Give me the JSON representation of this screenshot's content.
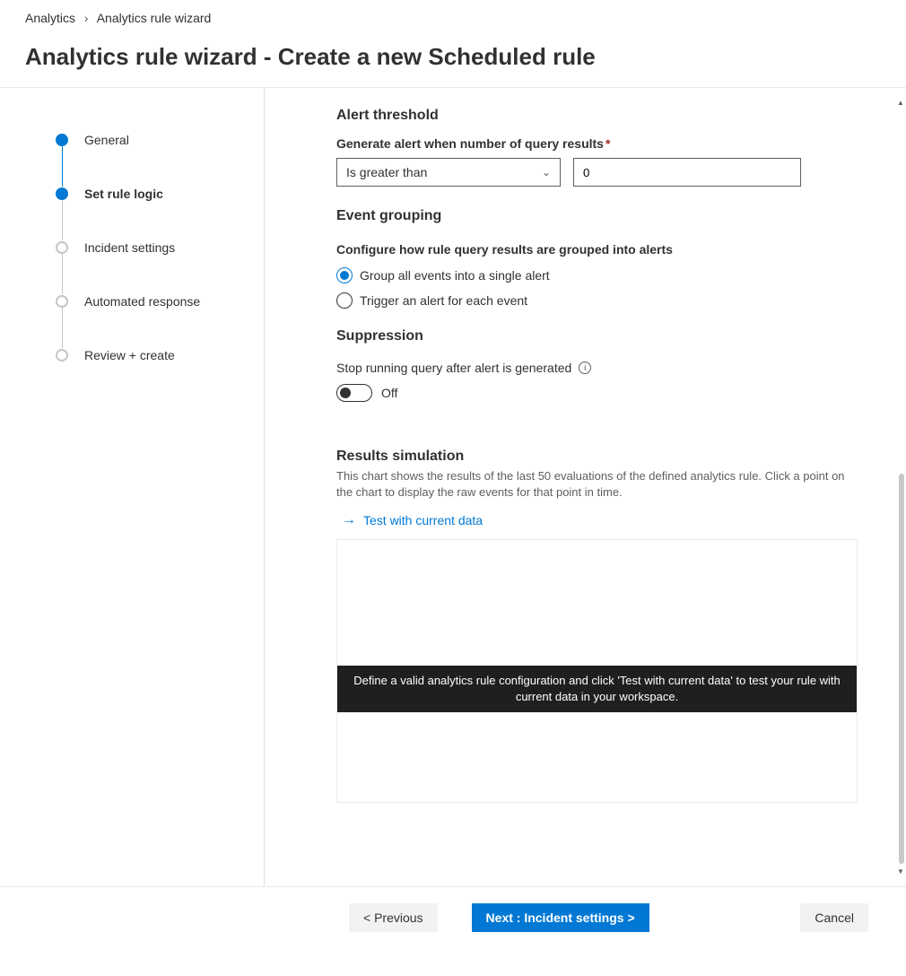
{
  "breadcrumb": {
    "root": "Analytics",
    "current": "Analytics rule wizard"
  },
  "page_title": "Analytics rule wizard - Create a new Scheduled rule",
  "steps": [
    {
      "label": "General"
    },
    {
      "label": "Set rule logic"
    },
    {
      "label": "Incident settings"
    },
    {
      "label": "Automated response"
    },
    {
      "label": "Review + create"
    }
  ],
  "alert_threshold": {
    "heading": "Alert threshold",
    "label": "Generate alert when number of query results",
    "operator": "Is greater than",
    "value": "0"
  },
  "event_grouping": {
    "heading": "Event grouping",
    "hint": "Configure how rule query results are grouped into alerts",
    "opt1": "Group all events into a single alert",
    "opt2": "Trigger an alert for each event"
  },
  "suppression": {
    "heading": "Suppression",
    "label": "Stop running query after alert is generated",
    "state": "Off"
  },
  "results_sim": {
    "heading": "Results simulation",
    "desc": "This chart shows the results of the last 50 evaluations of the defined analytics rule. Click a point on the chart to display the raw events for that point in time.",
    "link": "Test with current data",
    "banner": "Define a valid analytics rule configuration and click 'Test with current data' to test your rule with current data in your workspace."
  },
  "footer": {
    "prev": "< Previous",
    "next": "Next : Incident settings >",
    "cancel": "Cancel"
  }
}
